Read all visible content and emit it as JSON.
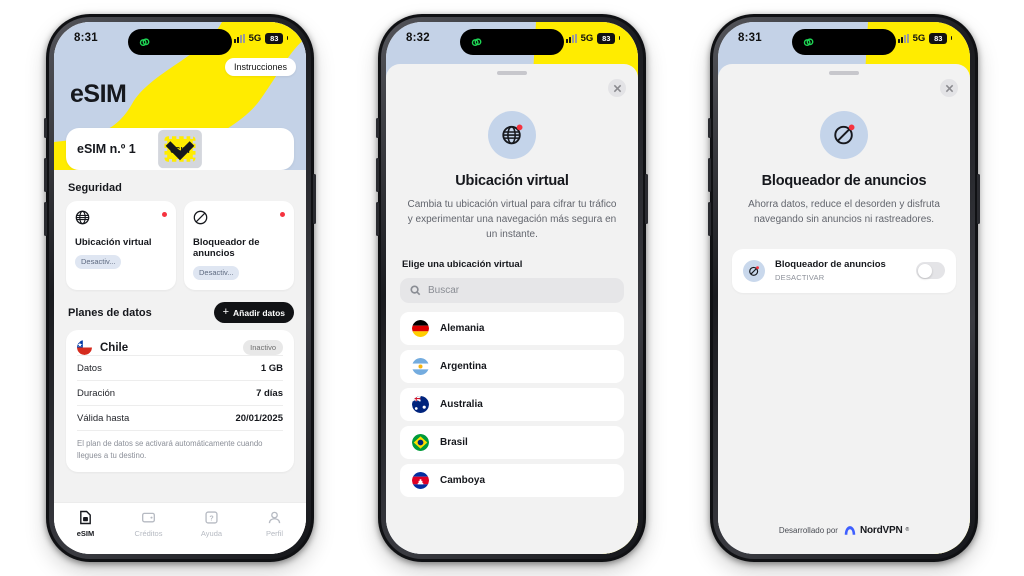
{
  "phones": [
    {
      "status_bar": {
        "time": "8:31",
        "network": "5G",
        "battery": "83",
        "vpn_icon": "vpn-link-icon"
      },
      "hero": {
        "title": "eSIM",
        "instructions_button": "Instrucciones",
        "esim_selector": {
          "label": "eSIM n.º 1",
          "icon": "esim-chip-icon",
          "chevron": "chevron-down-icon"
        }
      },
      "security": {
        "section_title": "Seguridad",
        "cards": [
          {
            "icon": "globe-icon",
            "name": "Ubicación virtual",
            "badge": "Desactiv...",
            "dot": "status-dot-red"
          },
          {
            "icon": "block-icon",
            "name": "Bloqueador de anuncios",
            "badge": "Desactiv...",
            "dot": "status-dot-red"
          }
        ]
      },
      "data_plans": {
        "section_title": "Planes de datos",
        "add_button": "Añadir datos",
        "plan": {
          "country": "Chile",
          "flag": "flag-chile",
          "status": "Inactivo",
          "rows": [
            {
              "key": "Datos",
              "value": "1 GB"
            },
            {
              "key": "Duración",
              "value": "7 días"
            },
            {
              "key": "Válida hasta",
              "value": "20/01/2025"
            }
          ],
          "note": "El plan de datos se activará automáticamente cuando llegues a tu destino."
        }
      },
      "tabbar": [
        {
          "label": "eSIM",
          "icon": "sim-card-icon",
          "active": true
        },
        {
          "label": "Créditos",
          "icon": "wallet-icon",
          "active": false
        },
        {
          "label": "Ayuda",
          "icon": "help-icon",
          "active": false
        },
        {
          "label": "Perfil",
          "icon": "person-icon",
          "active": false
        }
      ]
    },
    {
      "status_bar": {
        "time": "8:32",
        "network": "5G",
        "battery": "83",
        "vpn_icon": "vpn-link-icon"
      },
      "sheet": {
        "close_icon": "close-icon",
        "feature_icon": "globe-icon",
        "title": "Ubicación virtual",
        "description": "Cambia tu ubicación virtual para cifrar tu tráfico y experimentar una navegación más segura en un instante.",
        "choose_label": "Elige una ubicación virtual",
        "search_placeholder": "Buscar",
        "search_icon": "search-icon",
        "countries": [
          {
            "name": "Alemania",
            "flag": "flag-germany"
          },
          {
            "name": "Argentina",
            "flag": "flag-argentina"
          },
          {
            "name": "Australia",
            "flag": "flag-australia"
          },
          {
            "name": "Brasil",
            "flag": "flag-brazil"
          },
          {
            "name": "Camboya",
            "flag": "flag-cambodia"
          }
        ]
      }
    },
    {
      "status_bar": {
        "time": "8:31",
        "network": "5G",
        "battery": "83",
        "vpn_icon": "vpn-link-icon"
      },
      "sheet": {
        "close_icon": "close-icon",
        "feature_icon": "block-icon",
        "title": "Bloqueador de anuncios",
        "description": "Ahorra datos, reduce el desorden y disfruta navegando sin anuncios ni rastreadores.",
        "toggle": {
          "name": "Bloqueador de anuncios",
          "state": "DESACTIVAR",
          "on": false,
          "icon": "block-icon"
        },
        "footer": {
          "text": "Desarrollado por",
          "brand": "NordVPN",
          "trademark": "®",
          "logo": "nordvpn-logo"
        }
      }
    }
  ],
  "colors": {
    "hero_bg": "#c4d2e7",
    "accent_yellow": "#ffec00",
    "app_bg": "#f2f2f2",
    "text_dark": "#16181d",
    "status_red": "#f5333f",
    "nord_blue": "#3e5fff"
  }
}
